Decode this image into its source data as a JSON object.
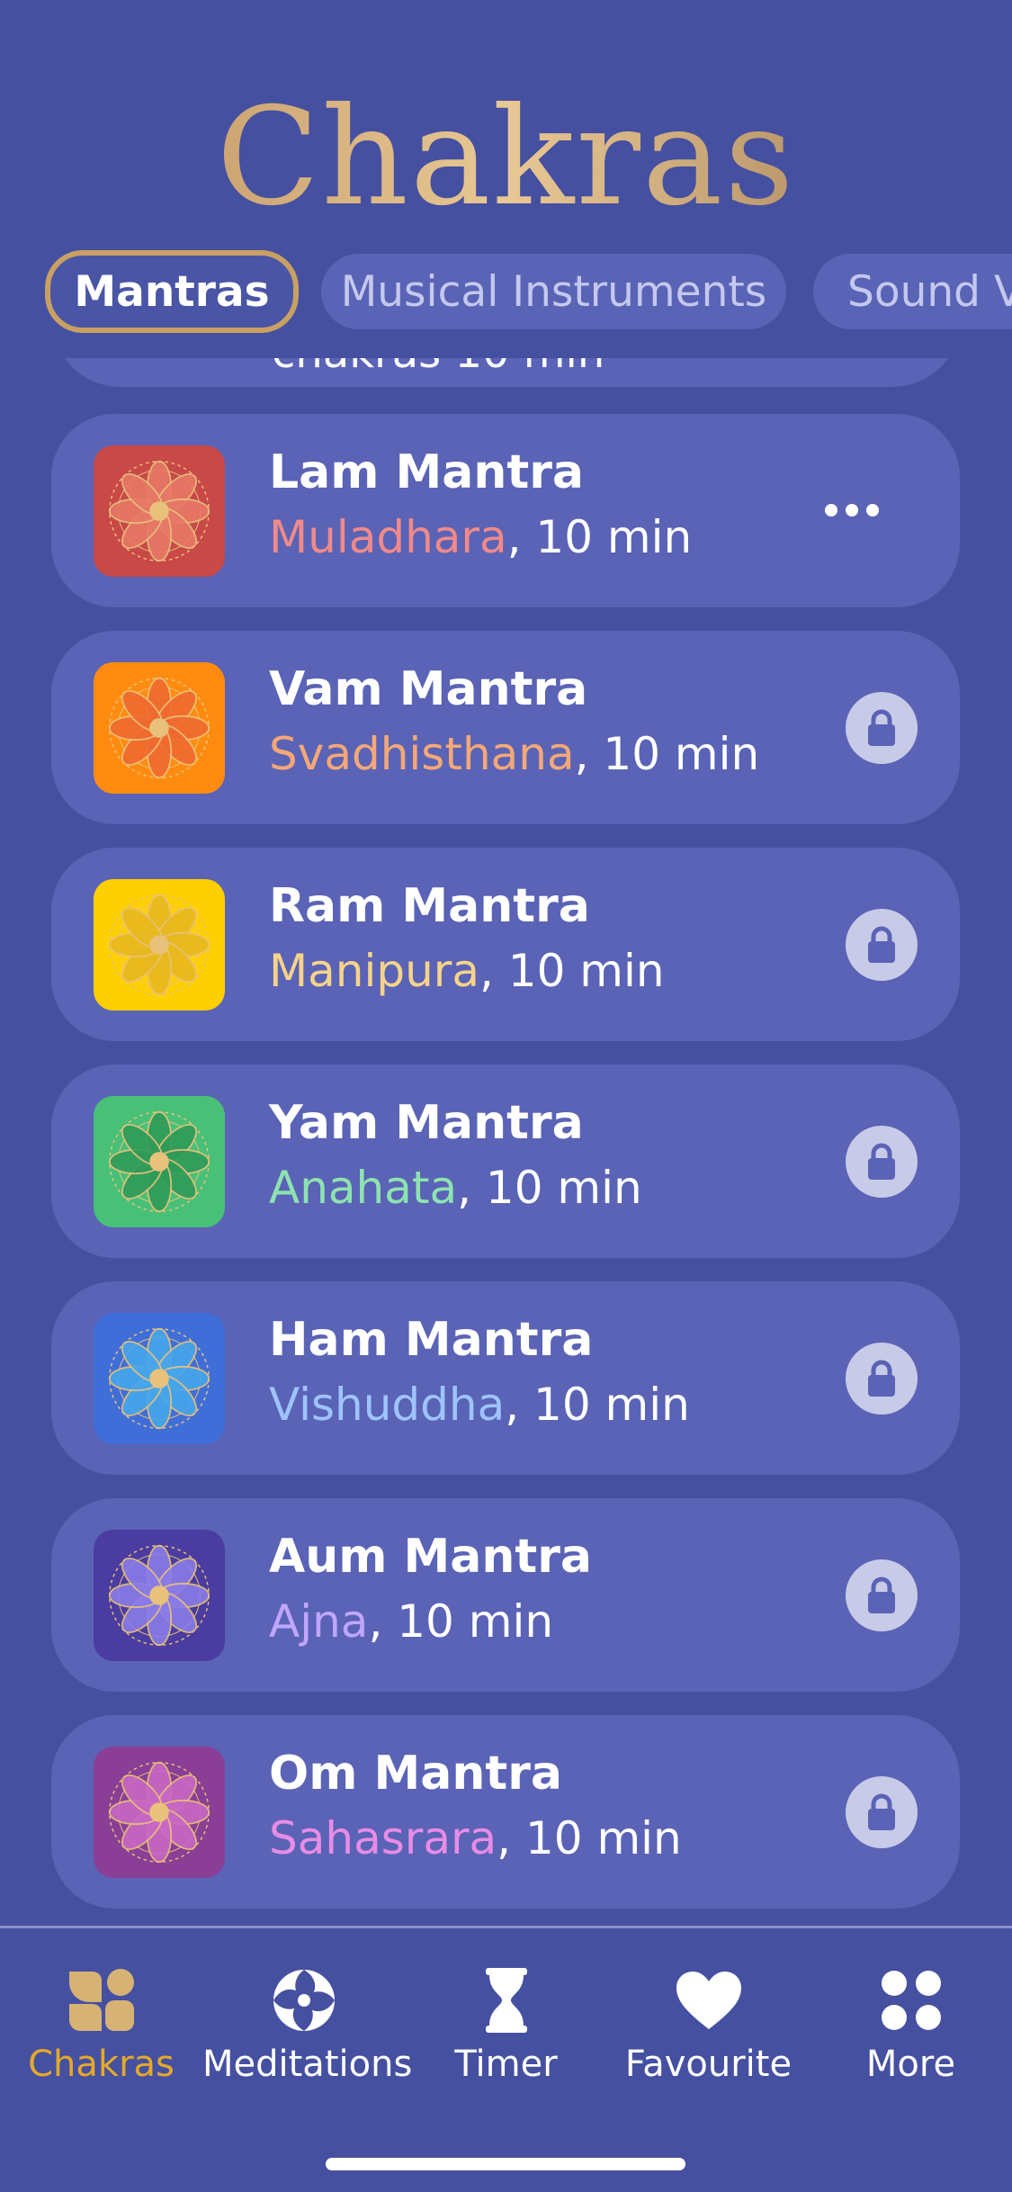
{
  "header": {
    "title": "Chakras"
  },
  "tabs": [
    {
      "label": "Mantras"
    },
    {
      "label": "Musical Instruments"
    },
    {
      "label": "Sound V"
    }
  ],
  "peek_item": {
    "text": "chakras 10 min"
  },
  "items": [
    {
      "title": "Lam Mantra",
      "chakra": "Muladhara",
      "duration": ", 10 min",
      "chakra_color": "#f08a8a",
      "thumb_color": "#c94848",
      "flower_color": "#e87868",
      "action": "more-icon"
    },
    {
      "title": "Vam Mantra",
      "chakra": "Svadhisthana",
      "duration": ", 10 min",
      "chakra_color": "#f4a878",
      "thumb_color": "#ff8c10",
      "flower_color": "#f06a30",
      "action": "lock-icon"
    },
    {
      "title": "Ram Mantra",
      "chakra": "Manipura",
      "duration": ", 10 min",
      "chakra_color": "#f5d48a",
      "thumb_color": "#ffd000",
      "flower_color": "#e8b820",
      "action": "lock-icon"
    },
    {
      "title": "Yam Mantra",
      "chakra": "Anahata",
      "duration": ", 10 min",
      "chakra_color": "#8ee3b0",
      "thumb_color": "#48c078",
      "flower_color": "#2f9b58",
      "action": "lock-icon"
    },
    {
      "title": "Ham Mantra",
      "chakra": "Vishuddha",
      "duration": ", 10 min",
      "chakra_color": "#9ec4ff",
      "thumb_color": "#3f6ed8",
      "flower_color": "#46a6ec",
      "action": "lock-icon"
    },
    {
      "title": "Aum Mantra",
      "chakra": "Ajna",
      "duration": ", 10 min",
      "chakra_color": "#c1a6ff",
      "thumb_color": "#4a3ca0",
      "flower_color": "#8a7ce8",
      "action": "lock-icon"
    },
    {
      "title": "Om Mantra",
      "chakra": "Sahasrara",
      "duration": ", 10 min",
      "chakra_color": "#e88ce6",
      "thumb_color": "#8a3e96",
      "flower_color": "#c868c4",
      "action": "lock-icon"
    }
  ],
  "tabbar": [
    {
      "label": "Chakras",
      "icon": "chakras-icon",
      "active": true
    },
    {
      "label": "Meditations",
      "icon": "meditations-icon",
      "active": false
    },
    {
      "label": "Timer",
      "icon": "hourglass-icon",
      "active": false
    },
    {
      "label": "Favourite",
      "icon": "heart-icon",
      "active": false
    },
    {
      "label": "More",
      "icon": "grid-icon",
      "active": false
    }
  ],
  "colors": {
    "background": "#4650a0",
    "card": "#5a63b6",
    "accent_gold": "#e3a92a",
    "active_tab_border": "#c9a063"
  }
}
